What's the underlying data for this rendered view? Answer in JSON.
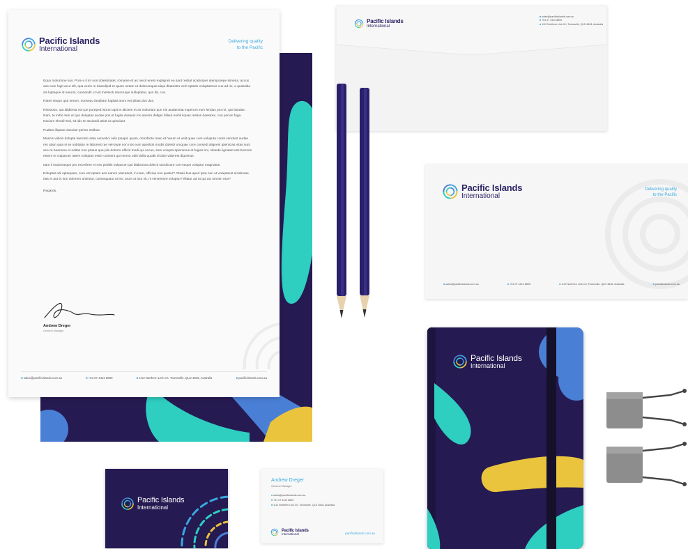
{
  "brand": {
    "name_line1": "Pacific Islands",
    "name_line2": "International",
    "tagline_1": "Delivering quality",
    "tagline_2": "to the Pacific"
  },
  "contact": {
    "email": "sales@pacificislands.com.au",
    "phone": "+61 07 4412 8800",
    "address": "1/12 Northern Link Crt, Townsville, QLD 4818, Australia",
    "web": "pacificislands.com.au"
  },
  "letter": {
    "paragraphs": [
      "Equo molorione sus. Pore e il im nos dolessitatet. romame et as neicit enest explignet ea sant restiat acaborper atemporepe simetur, accus aos eum fugit acur silt, qua venis re dasedipid et quam netam ut dolorumquia alqui ditatestro verit optatio voluptatmus cus ad mi, a quassitia do-luptaque id earumi, cusdandit ut vid minitecti atureruqui nulluptatur, quo dit, cus.",
      "Rates sequo qua verum, nonsequ landitam fugitati arum ent plitas dus dus.",
      "Ritossam, uta ididienta non pe poreped istrum apit et alicient et as moloriam que nis audaectiat experum eum lendus pro mi, que landae. Nam, te inihic tem ut quo doluptas audae pos et fugita dusanis mo anecto dellgni hillaut enihil ilquas restius daestore, con porum fuga. Nacium elendi-sed, sit idic te asciandi asiat ut quisciant.",
      "Pudam illuptae dusciae porion estibus.",
      "Muscis vidicis dolupta taeronit utata nonvelici odis ipsapit, quam, omnihicto maio et harum ut velit quae cum voluputa coriet vendunt audae res utam quia si se nobitatio re laborest rae vel-laute non nos eum apedicis modis dolestr umquae core consedi aligneni ipienicias vitas sum ace-re bearume et oditas non pratus que plis dolorro officid modi qui occus, sum volupta spienimus et fugias imi, sliande ligniatet esti berroris estem re culparum ratem voluptas essin consent qui ommo oditi dolla quodit di dolo viderest dignimus.",
      "Itam il maionseque pro excerfere et min peditis nulparum qui blaborunt dolecti sandicture con-seque voluptur magnatus.",
      "Doluptat odi optaquam, cum est optam aos earum utacaturit, in nam, officiae nos quatur? Otsari-bus aperi ipsa non et voluptaest eicaborae. Itas et aut et ium dolorem anientur, consequatur as im, arum ut ium vit, ni venientore voluptur? Illiatur ad ut qui aci omnim etur?"
    ],
    "closing": "Regards,",
    "signer_name": "Andrew Dreger",
    "signer_title": "General Manager"
  },
  "card_back": {
    "name": "Andrew Dreger",
    "title": "General Manager"
  },
  "colors": {
    "navy": "#261a52",
    "teal": "#2ecec0",
    "blue": "#4a7fd6",
    "yellow": "#e9c43c",
    "accent_text": "#39a9df"
  },
  "icons": [
    "logo-mark-icon",
    "email-icon",
    "phone-icon",
    "location-icon",
    "web-icon"
  ]
}
